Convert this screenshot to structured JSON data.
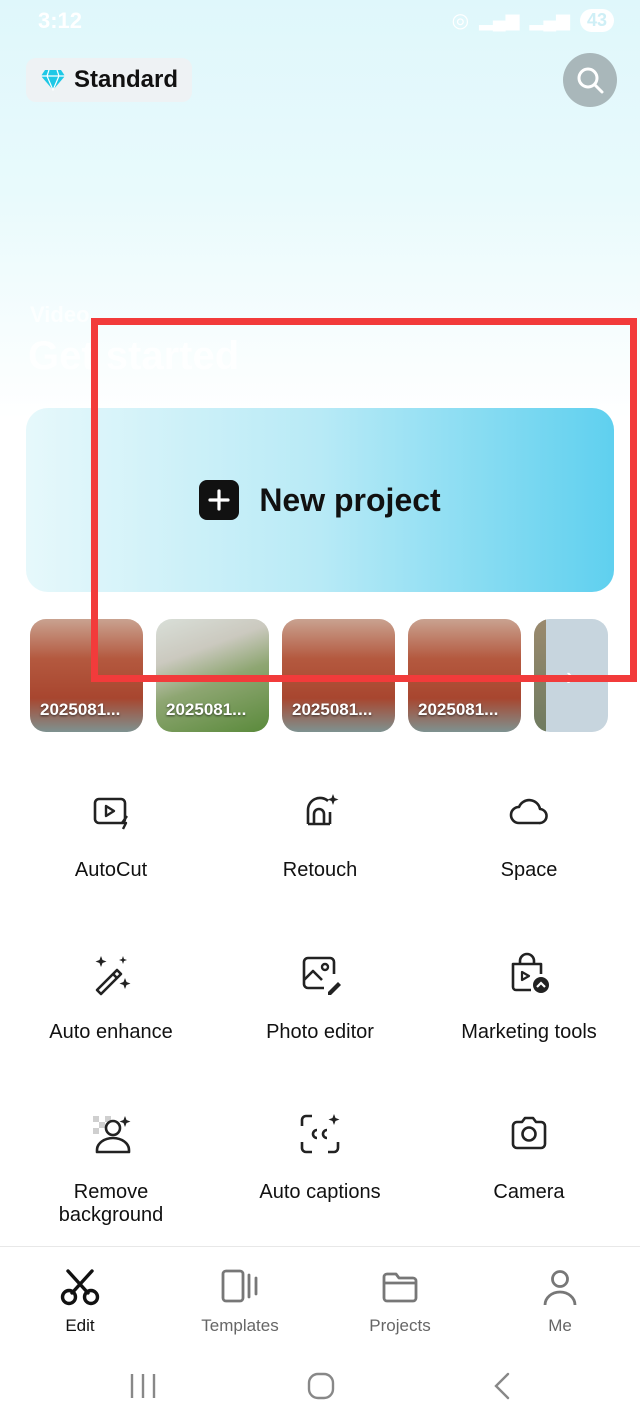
{
  "status": {
    "time": "3:12",
    "battery": "43"
  },
  "header": {
    "plan_label": "Standard"
  },
  "intro": {
    "line1": "Video",
    "line2": "Get started"
  },
  "new_project": {
    "label": "New project"
  },
  "recent_media": [
    {
      "label": "2025081..."
    },
    {
      "label": "2025081..."
    },
    {
      "label": "2025081..."
    },
    {
      "label": "2025081..."
    }
  ],
  "tools": [
    {
      "label": "AutoCut",
      "icon": "autocut-icon"
    },
    {
      "label": "Retouch",
      "icon": "retouch-icon"
    },
    {
      "label": "Space",
      "icon": "cloud-icon"
    },
    {
      "label": "Auto enhance",
      "icon": "magic-wand-icon"
    },
    {
      "label": "Photo editor",
      "icon": "photo-edit-icon"
    },
    {
      "label": "Marketing tools",
      "icon": "shopping-bag-icon"
    },
    {
      "label": "Remove background",
      "icon": "remove-background-icon"
    },
    {
      "label": "Auto captions",
      "icon": "captions-icon"
    },
    {
      "label": "Camera",
      "icon": "camera-icon"
    }
  ],
  "tabs": [
    {
      "label": "Edit",
      "icon": "scissors-icon",
      "active": true
    },
    {
      "label": "Templates",
      "icon": "templates-icon"
    },
    {
      "label": "Projects",
      "icon": "folder-icon"
    },
    {
      "label": "Me",
      "icon": "person-icon"
    }
  ],
  "colors": {
    "highlight": "#f23b3b",
    "accent": "#5fd0ef",
    "diamond": "#1ec8e6"
  }
}
